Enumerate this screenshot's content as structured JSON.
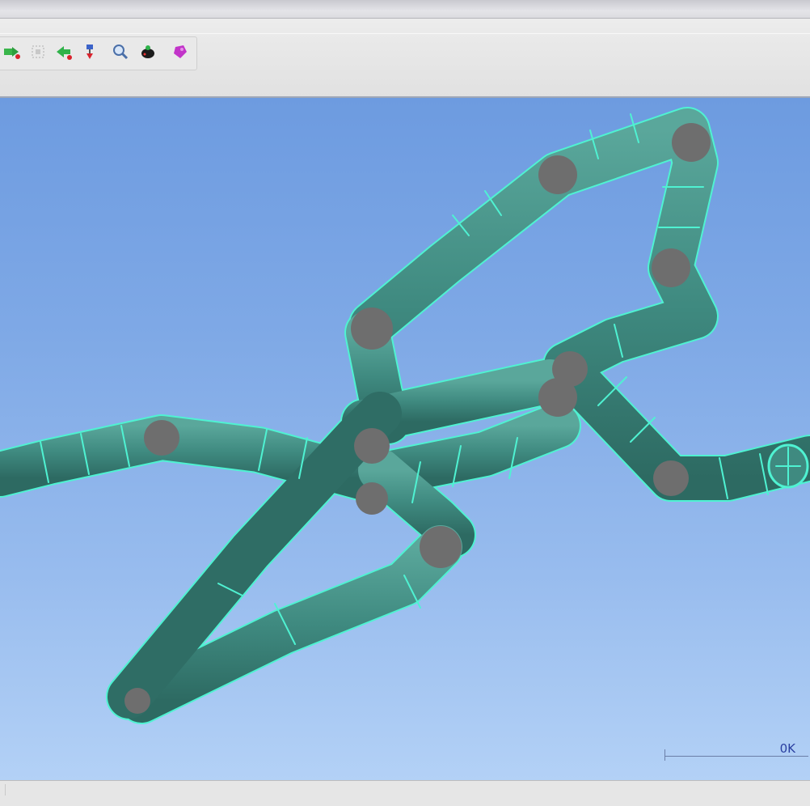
{
  "toolbar": {
    "icons": [
      "insert-node-icon",
      "select-icon",
      "move-icon",
      "rotate-icon",
      "zoom-icon",
      "render-icon",
      "paint-icon"
    ]
  },
  "viewport": {
    "scale_label": "0K"
  },
  "statusbar": {
    "left_text": "",
    "right_text": ""
  },
  "colors": {
    "pipe": "#3f8a80",
    "pipe_edge": "#4ff2d2",
    "elbow": "#6f6f6f",
    "background_top": "#6d9be0",
    "background_bottom": "#b3d1f6"
  }
}
